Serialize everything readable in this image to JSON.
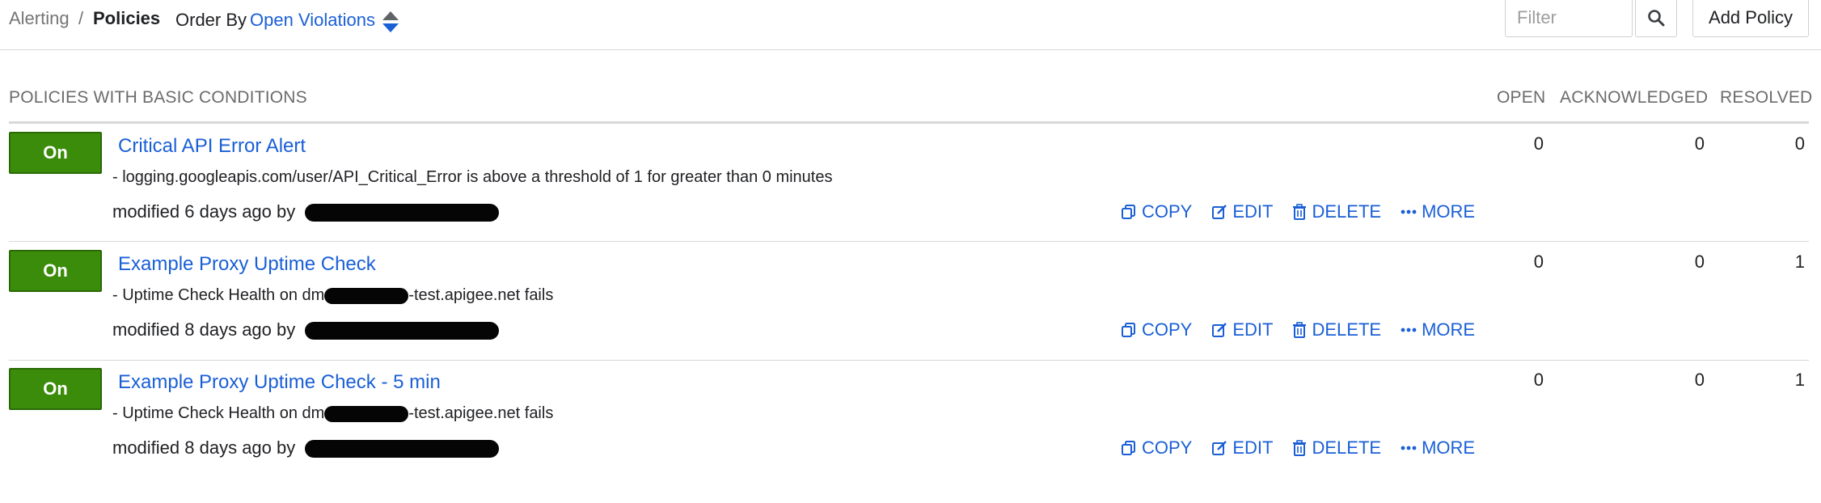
{
  "breadcrumb": {
    "parent": "Alerting",
    "separator": "/",
    "current": "Policies"
  },
  "order_by": {
    "label": "Order By",
    "value": "Open Violations"
  },
  "filter": {
    "placeholder": "Filter",
    "value": ""
  },
  "add_policy_label": "Add Policy",
  "section": {
    "title": "POLICIES WITH BASIC CONDITIONS",
    "columns": {
      "open": "OPEN",
      "acknowledged": "ACKNOWLEDGED",
      "resolved": "RESOLVED"
    }
  },
  "actions": {
    "copy": "COPY",
    "edit": "EDIT",
    "delete": "DELETE",
    "more": "MORE"
  },
  "policies": [
    {
      "status": "On",
      "name": "Critical API Error Alert",
      "description": "- logging.googleapis.com/user/API_Critical_Error is above a threshold of 1 for greater than 0 minutes",
      "modified": "modified 6 days ago by",
      "open": "0",
      "acknowledged": "0",
      "resolved": "0"
    },
    {
      "status": "On",
      "name": "Example Proxy Uptime Check",
      "description_prefix": "- Uptime Check Health on dm",
      "description_suffix": "-test.apigee.net fails",
      "modified": "modified 8 days ago by",
      "open": "0",
      "acknowledged": "0",
      "resolved": "1"
    },
    {
      "status": "On",
      "name": "Example Proxy Uptime Check - 5 min",
      "description_prefix": "- Uptime Check Health on dm",
      "description_suffix": "-test.apigee.net fails",
      "modified": "modified 8 days ago by",
      "open": "0",
      "acknowledged": "0",
      "resolved": "1"
    }
  ],
  "colors": {
    "link": "#1a5fd6",
    "toggle_on": "#3a8c0a",
    "muted": "#6b6b6b"
  }
}
